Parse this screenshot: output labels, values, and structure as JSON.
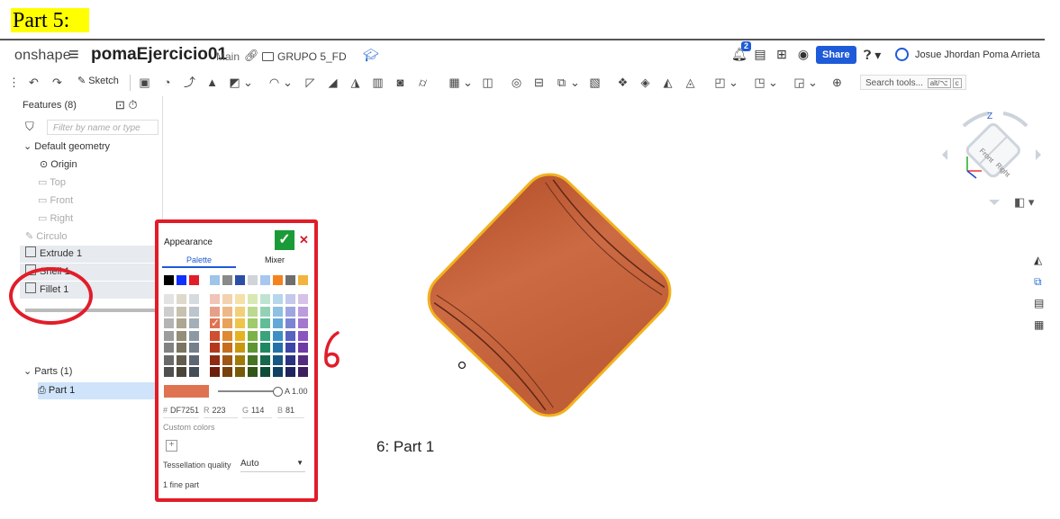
{
  "annotation_title": "Part 5:",
  "header": {
    "logo": "onshape",
    "document_title": "pomaEjercicio01",
    "branch": "Main",
    "folder": "GRUPO 5_FD",
    "notification_count": "2",
    "share_label": "Share",
    "user_name": "Josue Jhordan Poma Arrieta"
  },
  "toolbar": {
    "sketch_label": "Sketch",
    "search_placeholder": "Search tools...",
    "search_shortcut_1": "alt/⌥",
    "search_shortcut_2": "c"
  },
  "feature_panel": {
    "title": "Features (8)",
    "filter_placeholder": "Filter by name or type",
    "default_geometry": "Default geometry",
    "origin": "Origin",
    "planes": [
      "Top",
      "Front",
      "Right"
    ],
    "sketch": "Circulo",
    "features": [
      "Extrude 1",
      "Shell 1",
      "Fillet 1"
    ],
    "parts_header": "Parts (1)",
    "part": "Part 1"
  },
  "appearance": {
    "title": "Appearance",
    "tab_palette": "Palette",
    "tab_mixer": "Mixer",
    "selected_color": "#DF7251",
    "alpha_label": "A",
    "alpha_value": "1.00",
    "hex_label": "#",
    "hex_value": "DF7251",
    "r_label": "R",
    "r_value": "223",
    "g_label": "G",
    "g_value": "114",
    "b_label": "B",
    "b_value": "81",
    "custom_colors": "Custom colors",
    "tessellation_label": "Tessellation quality",
    "tessellation_value": "Auto",
    "fine_part": "1 fine part"
  },
  "annotation_number": "6",
  "viewport_caption": "6: Part 1",
  "view_cube": {
    "z_label": "Z",
    "front": "Front",
    "right": "Right"
  },
  "colors": {
    "part_body": "#c8663e",
    "highlight_border": "#f2b21f",
    "annotation_red": "#e11d2a",
    "share_blue": "#1e5bd8"
  }
}
